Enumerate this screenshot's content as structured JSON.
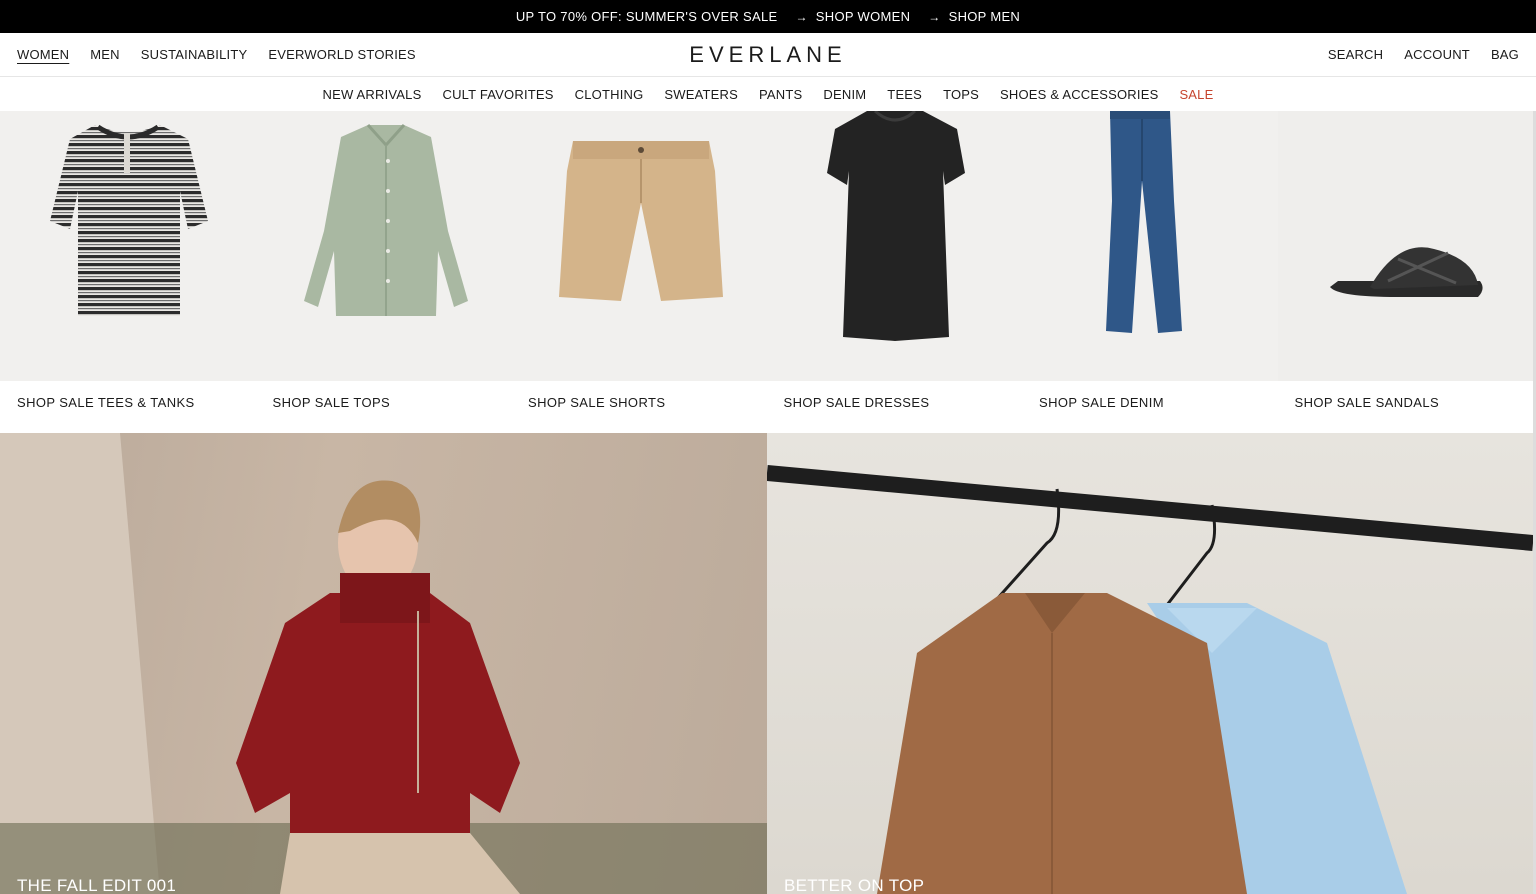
{
  "promo": {
    "text": "UP TO 70% OFF: SUMMER'S OVER SALE",
    "link1": "SHOP WOMEN",
    "link2": "SHOP MEN"
  },
  "nav": {
    "left": [
      "WOMEN",
      "MEN",
      "SUSTAINABILITY",
      "EVERWORLD STORIES"
    ],
    "logo": "EVERLANE",
    "right": [
      "SEARCH",
      "ACCOUNT",
      "BAG"
    ]
  },
  "categories": [
    "NEW ARRIVALS",
    "CULT FAVORITES",
    "CLOTHING",
    "SWEATERS",
    "PANTS",
    "DENIM",
    "TEES",
    "TOPS",
    "SHOES & ACCESSORIES",
    "SALE"
  ],
  "tiles": [
    {
      "label": "SHOP SALE TEES & TANKS"
    },
    {
      "label": "SHOP SALE TOPS"
    },
    {
      "label": "SHOP SALE SHORTS"
    },
    {
      "label": "SHOP SALE DRESSES"
    },
    {
      "label": "SHOP SALE DENIM"
    },
    {
      "label": "SHOP SALE SANDALS"
    }
  ],
  "hero": {
    "left_caption": "THE FALL EDIT 001",
    "right_caption": "BETTER ON TOP"
  },
  "colors": {
    "sale": "#c6452f",
    "sweater": "#8e1a1e",
    "shirt_brown": "#a06a45",
    "shirt_blue": "#a9cde8"
  }
}
